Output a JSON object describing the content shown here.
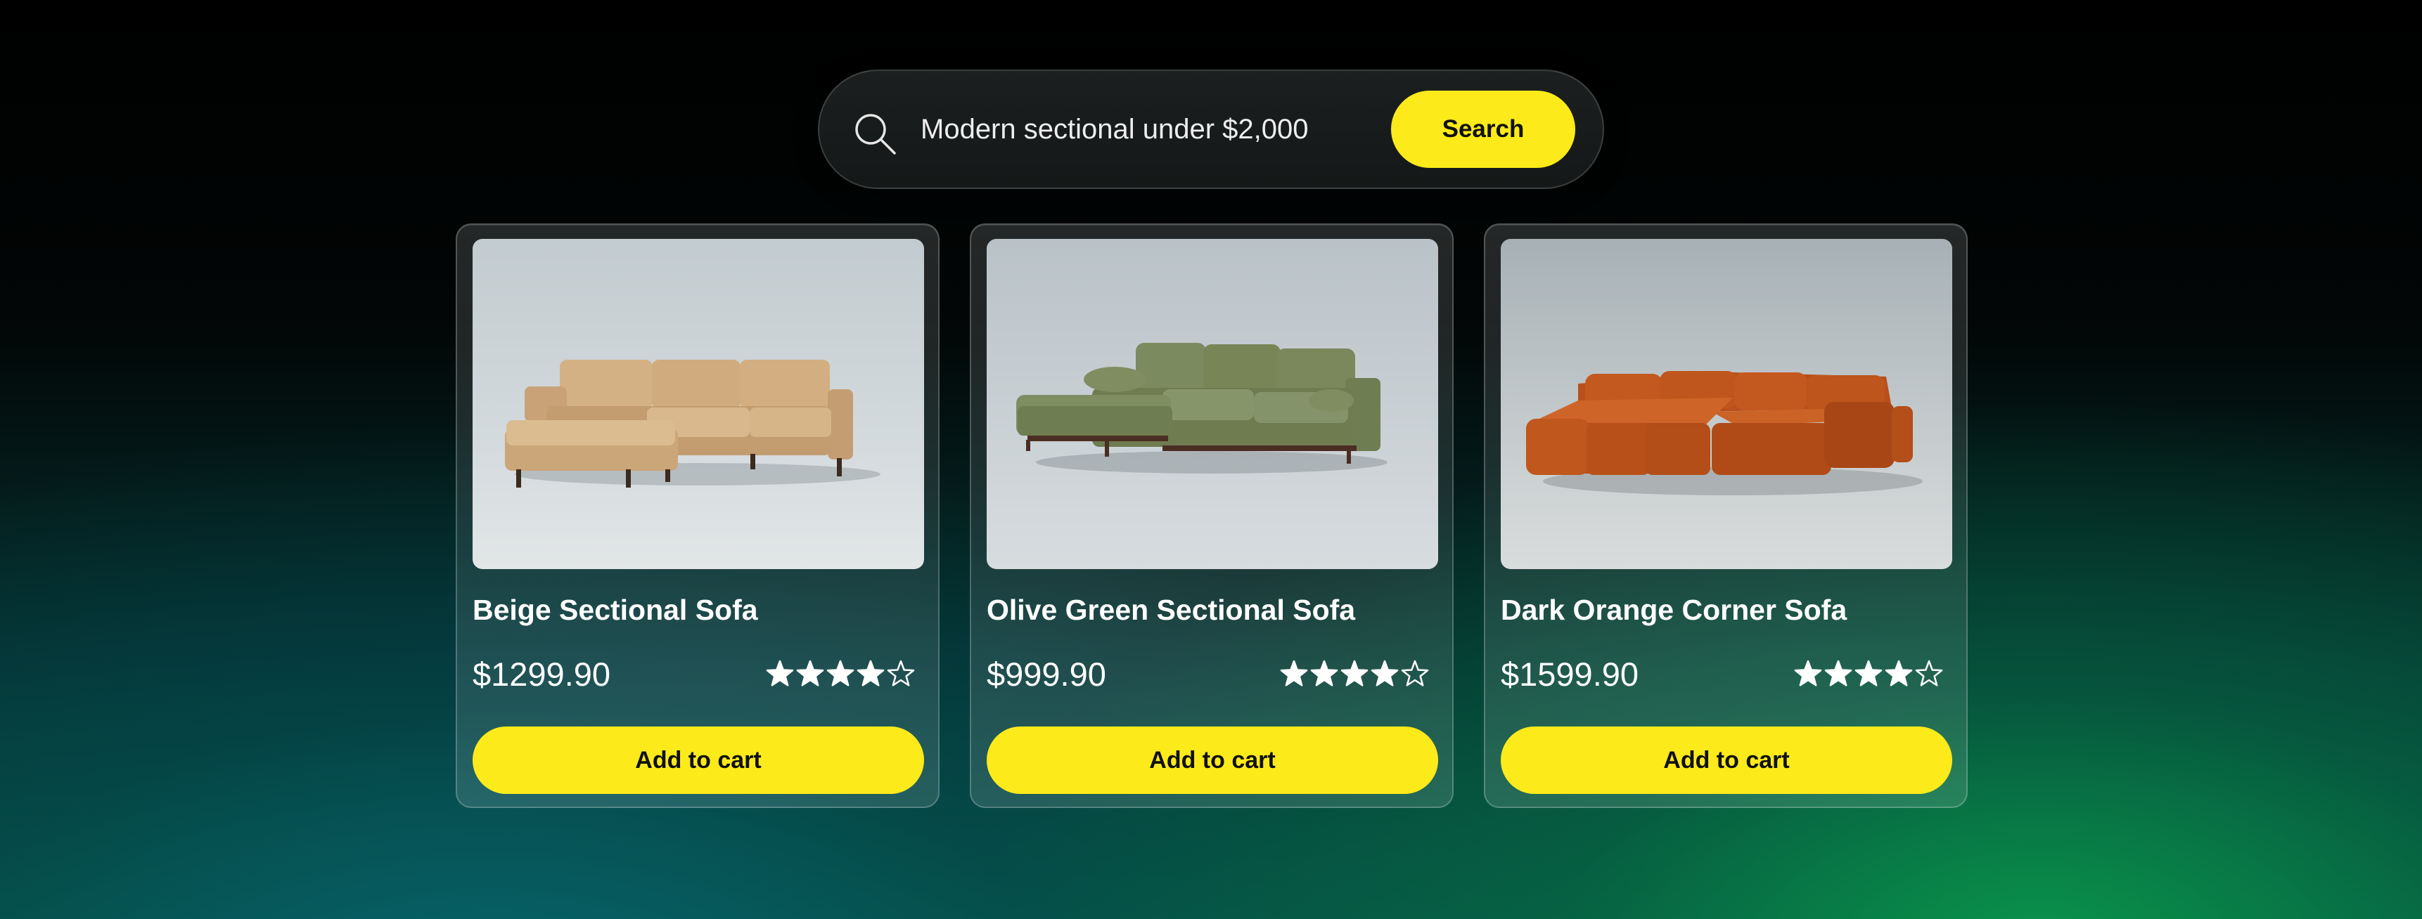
{
  "search": {
    "query": "Modern sectional under $2,000",
    "button_label": "Search",
    "icon": "search-icon"
  },
  "colors": {
    "accent": "#fcea1a",
    "card_text": "#ffffff",
    "button_text": "#111111"
  },
  "products": [
    {
      "name": "Beige Sectional Sofa",
      "price": "$1299.90",
      "rating": 4,
      "rating_max": 5,
      "button_label": "Add to cart",
      "image": "beige-sectional-sofa",
      "sofa_color": "#c9a47c"
    },
    {
      "name": "Olive Green Sectional Sofa",
      "price": "$999.90",
      "rating": 4,
      "rating_max": 5,
      "button_label": "Add to cart",
      "image": "olive-green-sectional-sofa",
      "sofa_color": "#7f8d62"
    },
    {
      "name": "Dark Orange Corner Sofa",
      "price": "$1599.90",
      "rating": 4,
      "rating_max": 5,
      "button_label": "Add to cart",
      "image": "dark-orange-corner-sofa",
      "sofa_color": "#c4591f"
    }
  ]
}
